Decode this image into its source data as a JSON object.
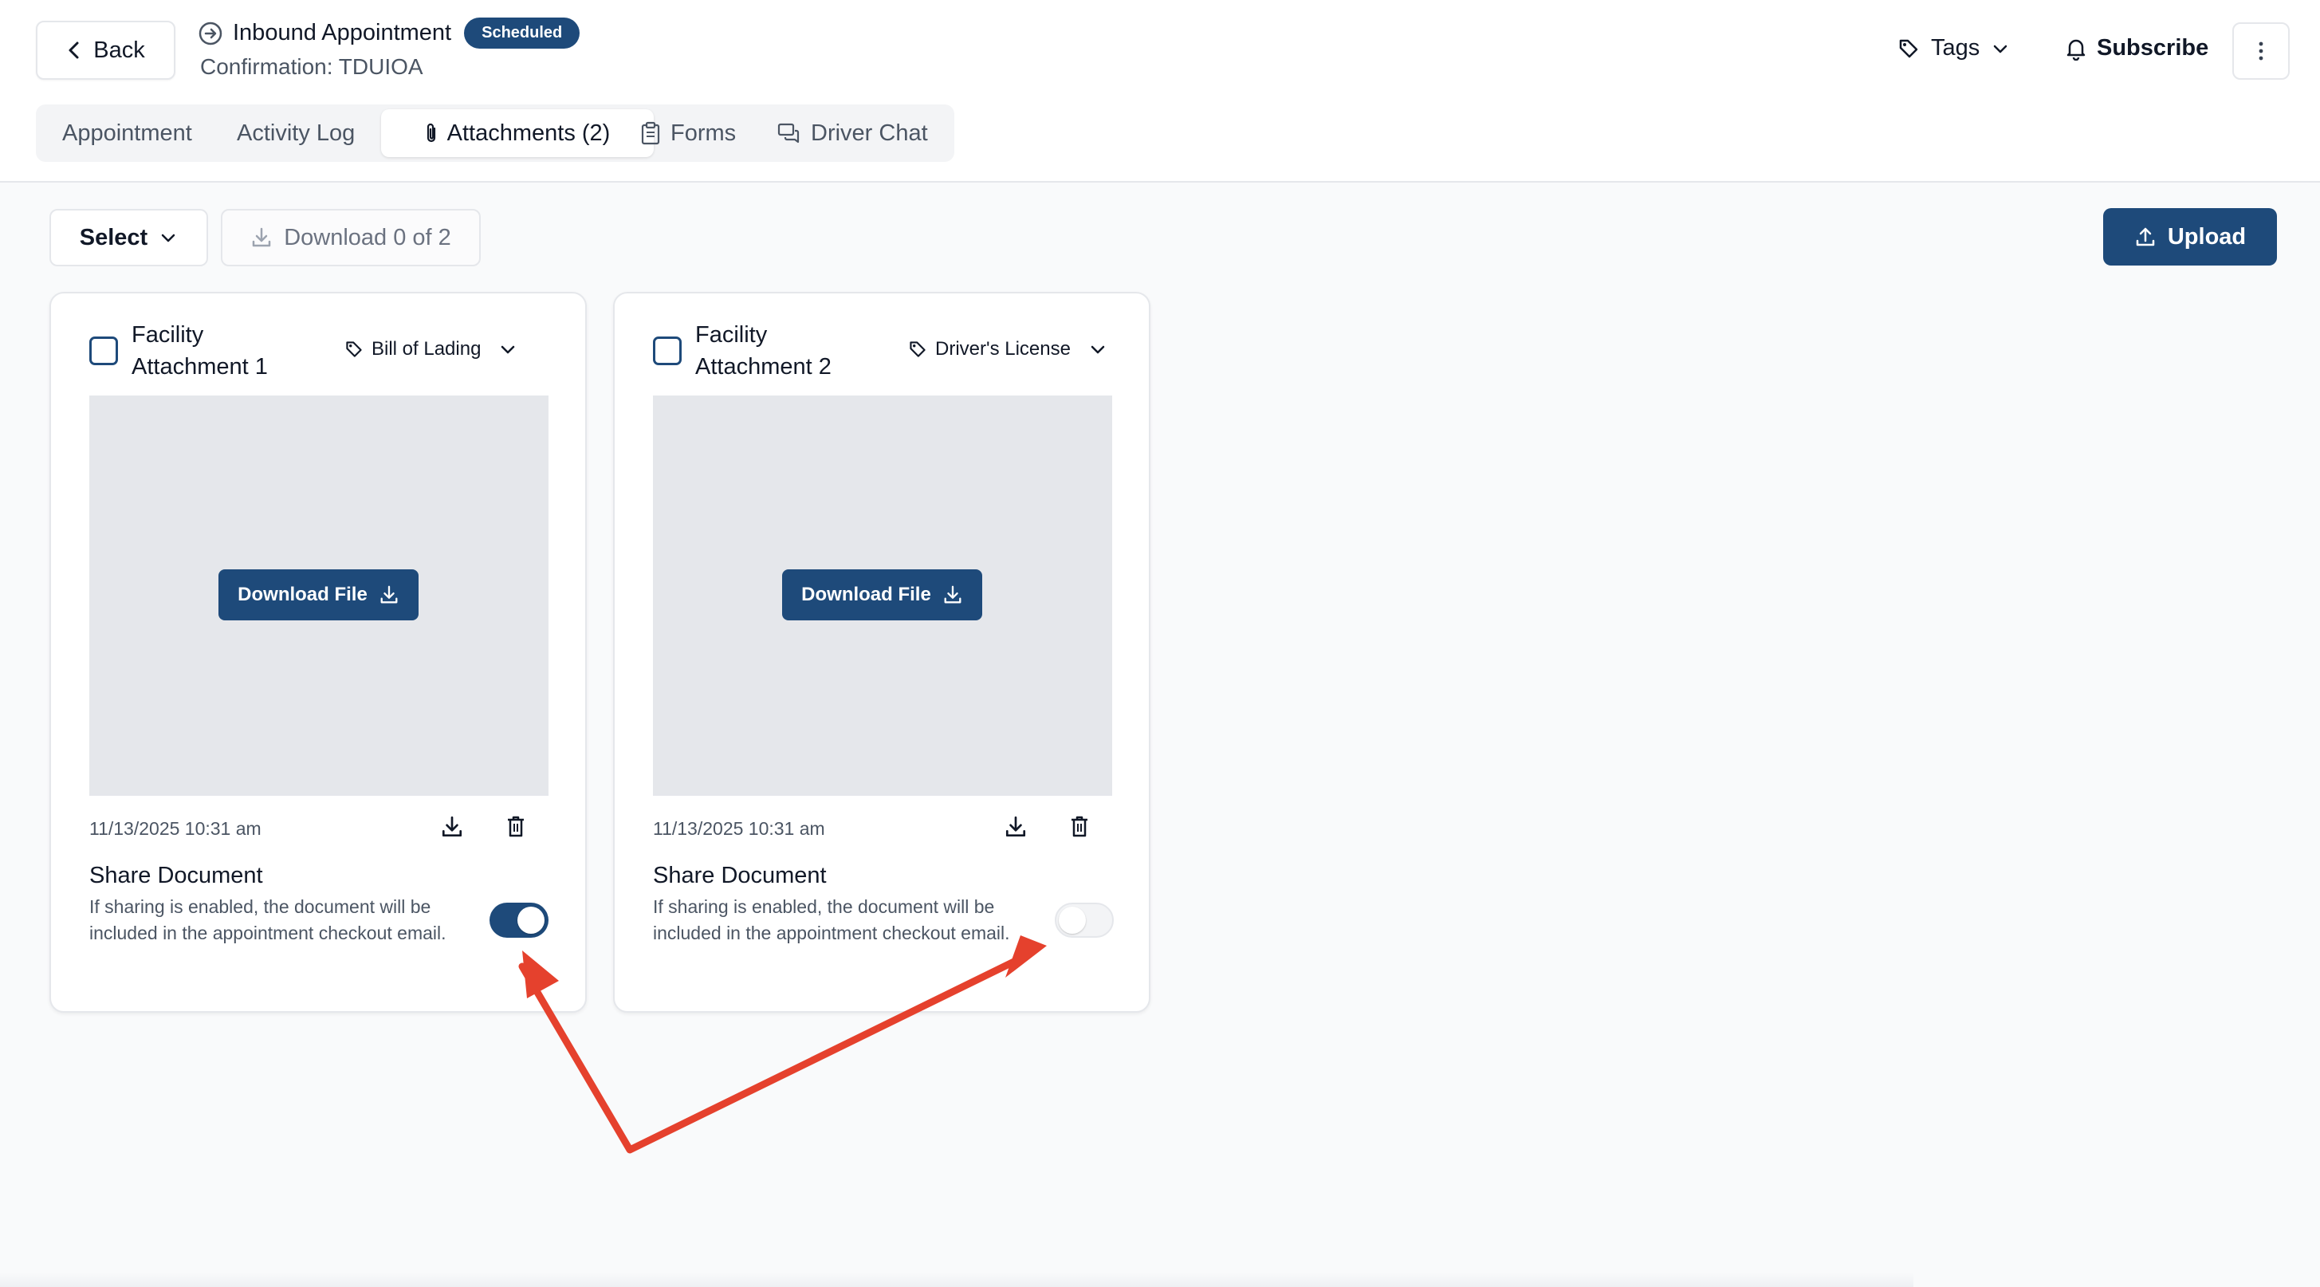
{
  "header": {
    "back_label": "Back",
    "title": "Inbound Appointment",
    "status_badge": "Scheduled",
    "confirmation": "Confirmation: TDUIOA",
    "tags_label": "Tags",
    "subscribe_label": "Subscribe"
  },
  "tabs": [
    {
      "label": "Appointment",
      "icon": "none",
      "active": false
    },
    {
      "label": "Activity Log",
      "icon": "none",
      "active": false
    },
    {
      "label": "Attachments (2)",
      "icon": "paperclip-icon",
      "active": true
    },
    {
      "label": "Forms",
      "icon": "clipboard-icon",
      "active": false
    },
    {
      "label": "Driver Chat",
      "icon": "chat-icon",
      "active": false
    }
  ],
  "toolbar": {
    "select_label": "Select",
    "download_label": "Download 0 of 2",
    "upload_label": "Upload"
  },
  "attachments": [
    {
      "title": "Facility Attachment 1",
      "doc_type": "Bill of Lading",
      "download_file_label": "Download File",
      "date": "11/13/2025 10:31 am",
      "share_title": "Share Document",
      "share_description": "If sharing is enabled, the document will be included in the appointment checkout email.",
      "share_enabled": true,
      "checked": false
    },
    {
      "title": "Facility Attachment 2",
      "doc_type": "Driver's License",
      "download_file_label": "Download File",
      "date": "11/13/2025 10:31 am",
      "share_title": "Share Document",
      "share_description": "If sharing is enabled, the document will be included in the appointment checkout email.",
      "share_enabled": false,
      "checked": false
    }
  ],
  "colors": {
    "primary": "#1e4a7a",
    "annotation_arrow": "#e5412d",
    "preview_bg": "#e5e7eb",
    "page_bg": "#f9fafb"
  }
}
